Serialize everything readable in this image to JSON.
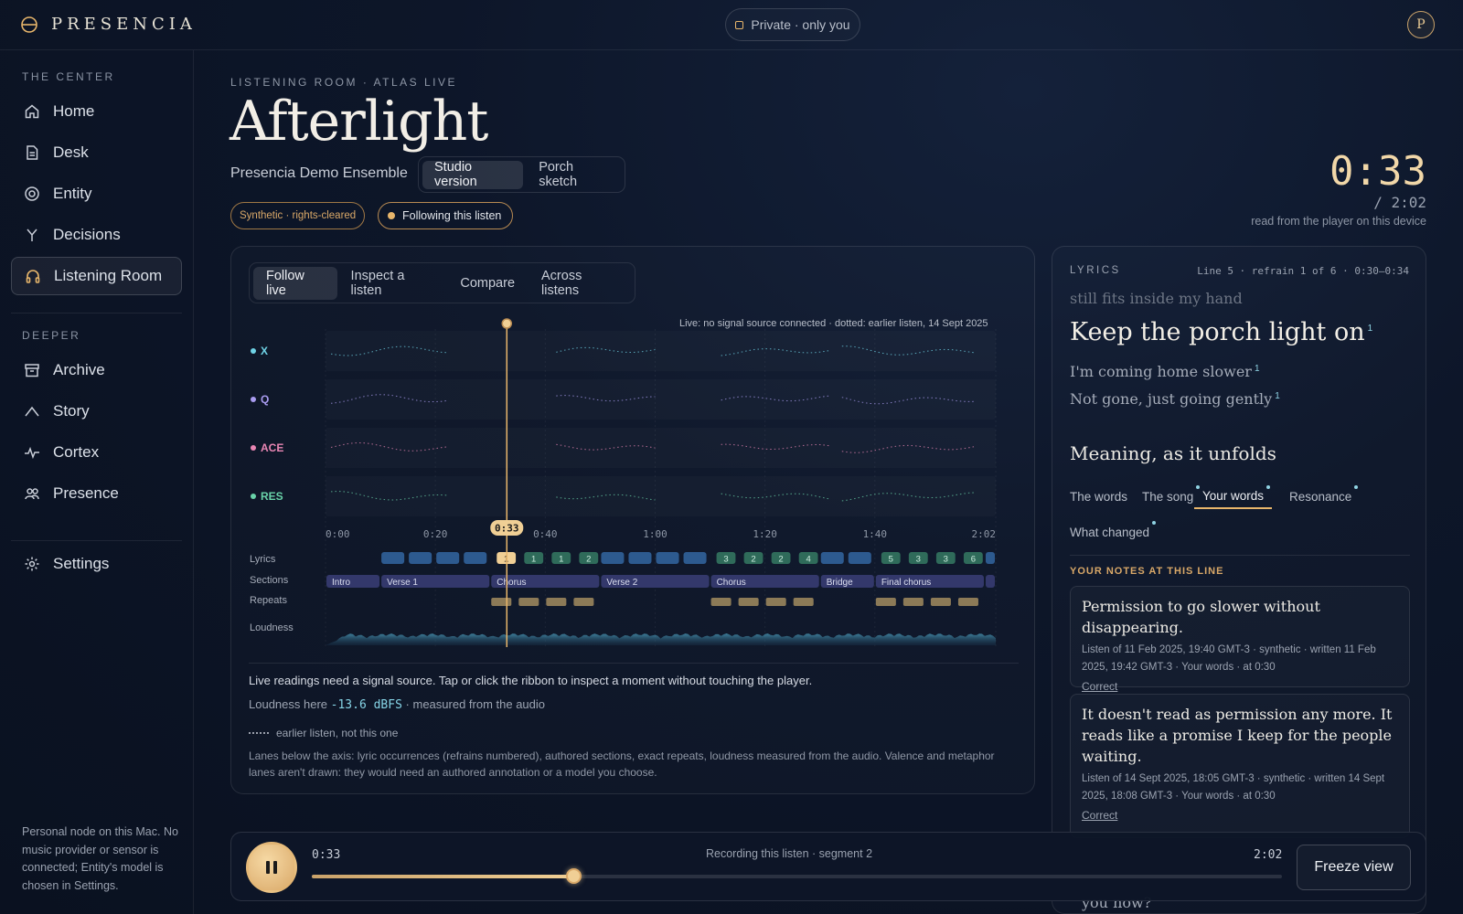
{
  "app": {
    "name": "PRESENCIA",
    "privacy": "Private · only you",
    "avatar_initial": "P"
  },
  "sidebar": {
    "section1": "THE CENTER",
    "items1": [
      {
        "label": "Home",
        "icon": "home-icon"
      },
      {
        "label": "Desk",
        "icon": "document-icon"
      },
      {
        "label": "Entity",
        "icon": "target-icon"
      },
      {
        "label": "Decisions",
        "icon": "branch-icon"
      },
      {
        "label": "Listening Room",
        "icon": "headphones-icon",
        "active": true
      }
    ],
    "section2": "DEEPER",
    "items2": [
      {
        "label": "Archive",
        "icon": "archive-icon"
      },
      {
        "label": "Story",
        "icon": "arc-icon"
      },
      {
        "label": "Cortex",
        "icon": "pulse-icon"
      },
      {
        "label": "Presence",
        "icon": "people-icon"
      }
    ],
    "settings": "Settings",
    "footer": "Personal node on this Mac. No music provider or sensor is connected; Entity's model is chosen in Settings."
  },
  "header": {
    "eyebrow": "LISTENING ROOM · ATLAS LIVE",
    "title": "Afterlight",
    "ensemble": "Presencia Demo Ensemble",
    "versions": [
      "Studio version",
      "Porch sketch"
    ],
    "active_version": "Studio version",
    "badge_synthetic": "Synthetic · rights-cleared",
    "badge_follow": "Following this listen",
    "clock": "0:33",
    "clock_total": "/ 2:02",
    "clock_note": "read from the player on this device"
  },
  "panel": {
    "tabs": [
      "Follow live",
      "Inspect a listen",
      "Compare",
      "Across listens"
    ],
    "active_tab": "Follow live",
    "live_note": "Live: no signal source connected · dotted: earlier listen, 14 Sept 2025",
    "playhead_label": "0:33",
    "line1": "Live readings need a signal source. Tap or click the ribbon to inspect a moment without touching the player.",
    "loudness_prefix": "Loudness here",
    "loudness_value": "-13.6 dBFS",
    "loudness_suffix": "· measured from the audio",
    "legend_dotted": "earlier listen, not this one",
    "lanes_note": "Lanes below the axis: lyric occurrences (refrains numbered), authored sections, exact repeats, loudness measured from the audio. Valence and metaphor lanes aren't drawn: they would need an authored annotation or a model you choose."
  },
  "chart_data": {
    "type": "line",
    "series": [
      {
        "name": "X",
        "color": "#6fd3e6"
      },
      {
        "name": "Q",
        "color": "#a99cf0"
      },
      {
        "name": "ACE",
        "color": "#e986b4"
      },
      {
        "name": "RES",
        "color": "#69d3a9"
      }
    ],
    "x_ticks": [
      "0:00",
      "0:20",
      "0:40",
      "1:00",
      "1:20",
      "1:40",
      "2:02"
    ],
    "xlim_seconds": [
      0,
      122
    ],
    "playhead_seconds": 33,
    "lanes": [
      "Lyrics",
      "Sections",
      "Repeats",
      "Loudness"
    ],
    "sections": [
      {
        "label": "Intro",
        "start": 0,
        "end": 10
      },
      {
        "label": "Verse 1",
        "start": 10,
        "end": 30
      },
      {
        "label": "Chorus",
        "start": 30,
        "end": 50
      },
      {
        "label": "Verse 2",
        "start": 50,
        "end": 70
      },
      {
        "label": "Chorus",
        "start": 70,
        "end": 90
      },
      {
        "label": "Bridge",
        "start": 90,
        "end": 100
      },
      {
        "label": "Final chorus",
        "start": 100,
        "end": 120
      }
    ],
    "lyric_refrains": [
      {
        "t": 31,
        "n": "1"
      },
      {
        "t": 36,
        "n": "1"
      },
      {
        "t": 41,
        "n": "1"
      },
      {
        "t": 46,
        "n": "2"
      },
      {
        "t": 71,
        "n": "3"
      },
      {
        "t": 76,
        "n": "2"
      },
      {
        "t": 81,
        "n": "2"
      },
      {
        "t": 86,
        "n": "4"
      },
      {
        "t": 101,
        "n": "5"
      },
      {
        "t": 106,
        "n": "3"
      },
      {
        "t": 111,
        "n": "3"
      },
      {
        "t": 116,
        "n": "6"
      }
    ]
  },
  "lyrics": {
    "heading": "LYRICS",
    "position": "Line 5 · refrain 1 of 6 · 0:30–0:34",
    "previous": "still fits inside my hand",
    "current": "Keep the porch light on",
    "next1": "I'm coming home slower",
    "next2": "Not gone, just going gently",
    "refrain_mark": "1"
  },
  "meaning": {
    "heading": "Meaning, as it unfolds",
    "tabs": [
      "The words",
      "The song",
      "Your words",
      "Resonance",
      "What changed"
    ],
    "active_tab": "Your words",
    "notes_heading": "YOUR NOTES AT THIS LINE",
    "notes": [
      {
        "text": "Permission to go slower without disappearing.",
        "meta": "Listen of 11 Feb 2025, 19:40 GMT-3 · synthetic · written 11 Feb 2025, 19:42 GMT-3 · Your words · at 0:30",
        "action": "Correct"
      },
      {
        "text": "It doesn't read as permission any more. It reads like a promise I keep for the people waiting.",
        "meta": "Listen of 14 Sept 2025, 18:05 GMT-3 · synthetic · written 14 Sept 2025, 18:08 GMT-3 · Your words · at 0:30",
        "action": "Correct"
      }
    ],
    "partial_note": "you now?"
  },
  "player": {
    "current": "0:33",
    "total": "2:02",
    "status": "Recording this listen · segment 2",
    "progress_fraction": 0.27,
    "freeze": "Freeze view"
  }
}
